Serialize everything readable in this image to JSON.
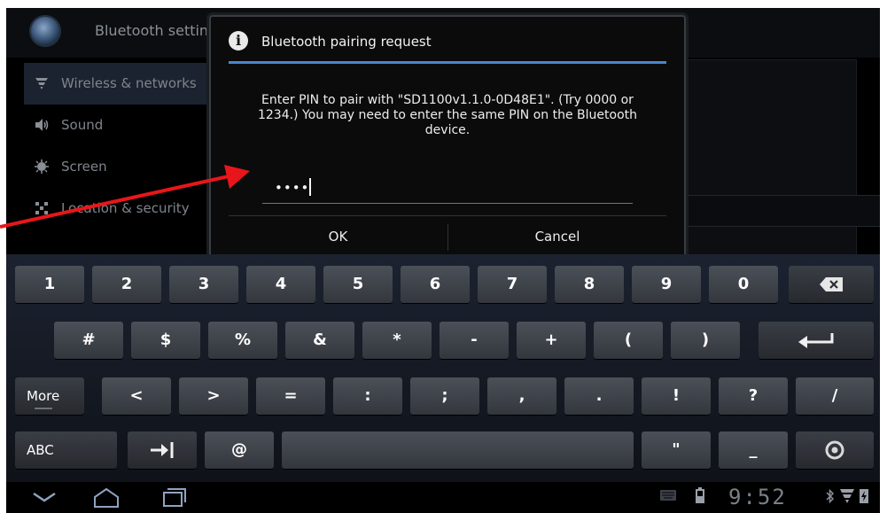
{
  "app": {
    "title": "Bluetooth setting",
    "settings_items": [
      {
        "label": "Wireless & networks",
        "icon": "wifi-icon",
        "selected": true
      },
      {
        "label": "Sound",
        "icon": "speaker-icon",
        "selected": false
      },
      {
        "label": "Screen",
        "icon": "brightness-icon",
        "selected": false
      },
      {
        "label": "Location & security",
        "icon": "location-icon",
        "selected": false
      }
    ]
  },
  "dialog": {
    "title": "Bluetooth pairing request",
    "icon": "info-icon",
    "message": "Enter PIN to pair with \"SD1100v1.1.0-0D48E1\". (Try 0000 or 1234.) You may need to enter the same PIN on the Bluetooth device.",
    "pin_masked": "••••",
    "ok_label": "OK",
    "cancel_label": "Cancel",
    "accent_color": "#4a86d1"
  },
  "keyboard": {
    "row1": [
      "1",
      "2",
      "3",
      "4",
      "5",
      "6",
      "7",
      "8",
      "9",
      "0"
    ],
    "row2": [
      "#",
      "$",
      "%",
      "&",
      "*",
      "-",
      "+",
      "(",
      ")"
    ],
    "row3_more": "More",
    "row3": [
      "<",
      ">",
      "=",
      ":",
      ";",
      ",",
      ".",
      "!",
      "?",
      "/"
    ],
    "row4_abc": "ABC",
    "row4_at": "@",
    "row4_quote": "\"",
    "row4_underscore": "_",
    "icons": [
      "backspace-icon",
      "enter-icon",
      "tab-icon",
      "voice-settings-icon"
    ]
  },
  "systembar": {
    "clock": "9:52",
    "nav_icons": [
      "back-icon",
      "home-icon",
      "recent-apps-icon"
    ],
    "status_icons": [
      "keyboard-icon",
      "battery-icon",
      "bluetooth-icon",
      "signal-icon",
      "charging-icon"
    ]
  },
  "annotation": {
    "color": "#e8161a"
  }
}
